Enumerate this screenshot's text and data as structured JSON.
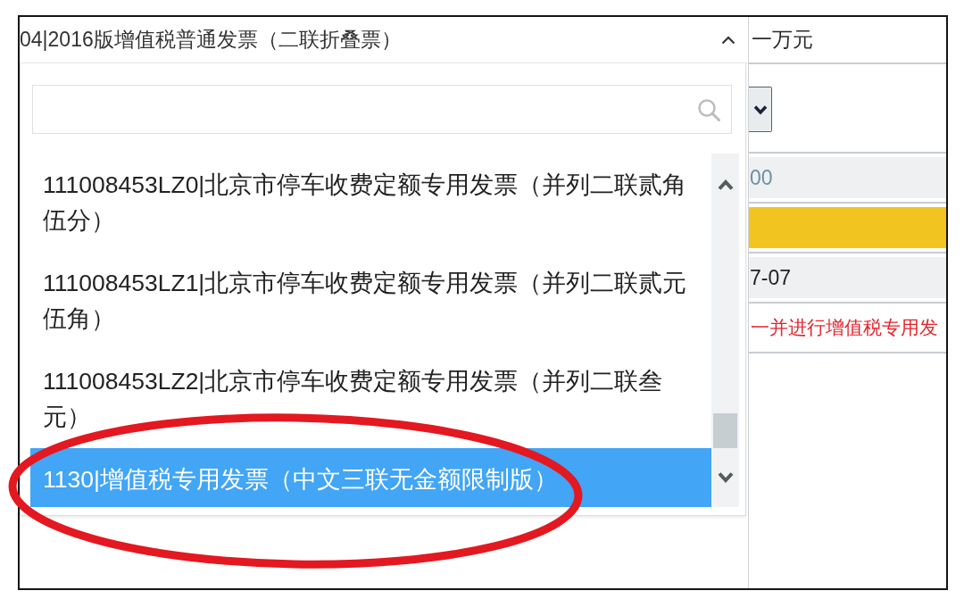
{
  "invoice_type_select": {
    "value": "04|2016版增值税普通发票（二联折叠票）",
    "expanded": true,
    "options": [
      {
        "label": "111008453LZ0|北京市停车收费定额专用发票（并列二联贰角伍分）",
        "selected": false
      },
      {
        "label": "111008453LZ1|北京市停车收费定额专用发票（并列二联贰元伍角）",
        "selected": false
      },
      {
        "label": "111008453LZ2|北京市停车收费定额专用发票（并列二联叁元）",
        "selected": false
      },
      {
        "label": "1130|增值税专用发票（中文三联无金额限制版）",
        "selected": true
      }
    ]
  },
  "side_fields": [
    {
      "kind": "text",
      "text": "一万元"
    },
    {
      "kind": "select"
    },
    {
      "kind": "input",
      "placeholder": "00"
    },
    {
      "kind": "highlighted_input"
    },
    {
      "kind": "input",
      "value": "7-07"
    },
    {
      "kind": "warning",
      "text": "一并进行增值税专用发"
    }
  ],
  "annotations": [
    {
      "kind": "ellipse"
    }
  ]
}
